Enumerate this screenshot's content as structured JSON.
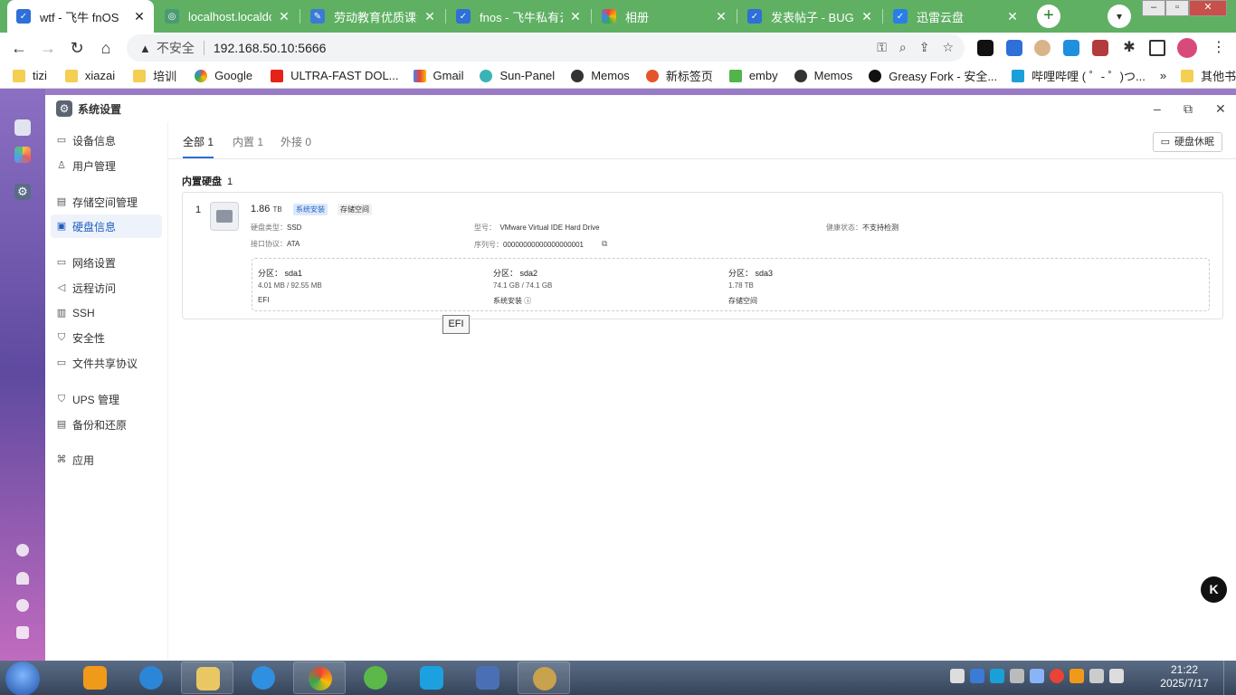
{
  "browser": {
    "tabs": [
      {
        "title": "wtf - 飞牛 fnOS",
        "active": true,
        "favicon": "fnos-icon"
      },
      {
        "title": "localhost.localdo",
        "active": false,
        "favicon": "localhost-icon"
      },
      {
        "title": "劳动教育优质课评",
        "active": false,
        "favicon": "edu-icon"
      },
      {
        "title": "fnos - 飞牛私有云",
        "active": false,
        "favicon": "fnos-icon"
      },
      {
        "title": "相册",
        "active": false,
        "favicon": "photos-icon"
      },
      {
        "title": "发表帖子 - BUG反",
        "active": false,
        "favicon": "fnos-icon"
      },
      {
        "title": "迅雷云盘",
        "active": false,
        "favicon": "xunlei-icon"
      }
    ],
    "address": {
      "security_label": "不安全",
      "url": "192.168.50.10:5666"
    },
    "bookmarks": [
      {
        "label": "tizi",
        "icon": "folder-icon"
      },
      {
        "label": "xiazai",
        "icon": "folder-icon"
      },
      {
        "label": "培训",
        "icon": "folder-icon"
      },
      {
        "label": "Google",
        "icon": "google-icon"
      },
      {
        "label": "ULTRA-FAST DOL...",
        "icon": "youtube-icon"
      },
      {
        "label": "Gmail",
        "icon": "gmail-icon"
      },
      {
        "label": "Sun-Panel",
        "icon": "sunpanel-icon"
      },
      {
        "label": "Memos",
        "icon": "memos-icon"
      },
      {
        "label": "新标签页",
        "icon": "weibo-icon"
      },
      {
        "label": "emby",
        "icon": "emby-icon"
      },
      {
        "label": "Memos",
        "icon": "memos-icon"
      },
      {
        "label": "Greasy Fork - 安全...",
        "icon": "greasyfork-icon"
      },
      {
        "label": "哔哩哔哩 ( ゜- ゜)つ...",
        "icon": "bilibili-icon"
      }
    ],
    "bookmarks_overflow": "»",
    "other_bookmarks": "其他书签"
  },
  "window": {
    "title": "系统设置",
    "controls": {
      "minimize": "–",
      "maximize": "⧉",
      "close": "✕"
    }
  },
  "sidebar": {
    "items": [
      {
        "label": "设备信息",
        "icon": "device-icon",
        "active": false
      },
      {
        "label": "用户管理",
        "icon": "user-icon",
        "active": false
      },
      {
        "label": "存储空间管理",
        "icon": "storage-icon",
        "active": false
      },
      {
        "label": "硬盘信息",
        "icon": "disk-icon",
        "active": true
      },
      {
        "label": "网络设置",
        "icon": "network-icon",
        "active": false
      },
      {
        "label": "远程访问",
        "icon": "remote-icon",
        "active": false
      },
      {
        "label": "SSH",
        "icon": "ssh-icon",
        "active": false
      },
      {
        "label": "安全性",
        "icon": "shield-icon",
        "active": false
      },
      {
        "label": "文件共享协议",
        "icon": "share-icon",
        "active": false
      },
      {
        "label": "UPS 管理",
        "icon": "ups-icon",
        "active": false
      },
      {
        "label": "备份和还原",
        "icon": "backup-icon",
        "active": false
      },
      {
        "label": "应用",
        "icon": "apps-icon",
        "active": false
      }
    ]
  },
  "main": {
    "tabs": [
      {
        "label": "全部 1",
        "active": true
      },
      {
        "label": "内置 1",
        "active": false
      },
      {
        "label": "外接 0",
        "active": false
      }
    ],
    "sleep_button": "硬盘休眠",
    "section": {
      "title": "内置硬盘",
      "count": "1"
    },
    "disk": {
      "index": "1",
      "capacity": "1.86",
      "capacity_unit": "TB",
      "tags": [
        "系统安装",
        "存储空间"
      ],
      "type_label": "硬盘类型：",
      "type": "SSD",
      "interface_label": "接口协议：",
      "interface": "ATA",
      "model_label": "型号：",
      "model": "VMware Virtual IDE Hard Drive",
      "serial_label": "序列号：",
      "serial": "00000000000000000001",
      "health_label": "健康状态：",
      "health": "不支持检测",
      "partitions": [
        {
          "name_label": "分区：",
          "name": "sda1",
          "size": "4.01 MB / 92.55 MB",
          "use": "EFI",
          "info": false
        },
        {
          "name_label": "分区：",
          "name": "sda2",
          "size": "74.1 GB / 74.1 GB",
          "use": "系统安装",
          "info": true
        },
        {
          "name_label": "分区：",
          "name": "sda3",
          "size": "1.78 TB",
          "use": "存储空间",
          "info": false
        }
      ]
    },
    "tooltip": "EFI"
  },
  "taskbar": {
    "clock_time": "21:22",
    "clock_date": "2025/7/17"
  },
  "colors": {
    "tabstrip": "#5fb063",
    "accent": "#2a6fd6",
    "desktop": "#7a5fb4"
  }
}
